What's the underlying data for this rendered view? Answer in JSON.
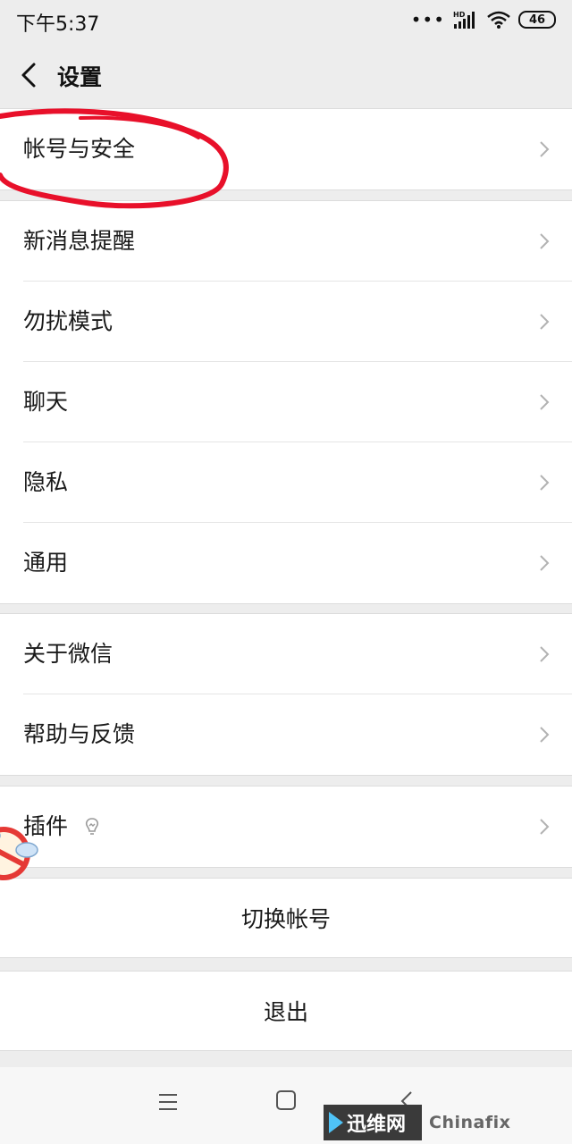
{
  "status_bar": {
    "time": "下午5:37",
    "signal_label": "HD",
    "battery": "46"
  },
  "header": {
    "title": "设置",
    "back_icon": "chevron-left-icon"
  },
  "groups": [
    {
      "items": [
        {
          "label": "帐号与安全"
        }
      ]
    },
    {
      "items": [
        {
          "label": "新消息提醒"
        },
        {
          "label": "勿扰模式"
        },
        {
          "label": "聊天"
        },
        {
          "label": "隐私"
        },
        {
          "label": "通用"
        }
      ]
    },
    {
      "items": [
        {
          "label": "关于微信"
        },
        {
          "label": "帮助与反馈"
        }
      ]
    },
    {
      "items": [
        {
          "label": "插件",
          "icon": "lightbulb-icon"
        }
      ]
    }
  ],
  "actions": {
    "switch_account": "切换帐号",
    "logout": "退出"
  },
  "annotation": {
    "color": "#e8102a"
  },
  "watermark": {
    "logo_text": "迅维网",
    "site_text": "Chinafix"
  }
}
